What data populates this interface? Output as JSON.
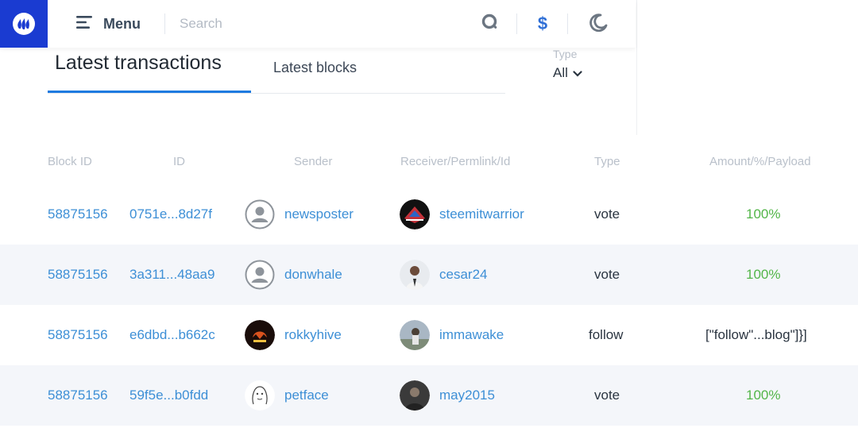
{
  "header": {
    "menu_label": "Menu",
    "search_placeholder": "Search",
    "currency_symbol": "$",
    "brand_color": "#1a3bd1",
    "icons": [
      "steem-logo-icon",
      "menu-icon",
      "search-icon",
      "dollar-icon",
      "moon-icon"
    ]
  },
  "tabs": [
    {
      "label": "Latest transactions",
      "active": true
    },
    {
      "label": "Latest blocks",
      "active": false
    }
  ],
  "filter": {
    "label": "Type",
    "value": "All"
  },
  "table": {
    "columns": [
      "Block ID",
      "ID",
      "Sender",
      "Receiver/Permlink/Id",
      "Type",
      "Amount/%/Payload"
    ],
    "rows": [
      {
        "block_id": "58875156",
        "id": "0751e...8d27f",
        "sender": "newsposter",
        "receiver": "steemitwarrior",
        "type": "vote",
        "amount": "100%"
      },
      {
        "block_id": "58875156",
        "id": "3a311...48aa9",
        "sender": "donwhale",
        "receiver": "cesar24",
        "type": "vote",
        "amount": "100%"
      },
      {
        "block_id": "58875156",
        "id": "e6dbd...b662c",
        "sender": "rokkyhive",
        "receiver": "immawake",
        "type": "follow",
        "amount": "[\"follow\"...blog\"]}]"
      },
      {
        "block_id": "58875156",
        "id": "59f5e...b0fdd",
        "sender": "petface",
        "receiver": "may2015",
        "type": "vote",
        "amount": "100%"
      }
    ]
  },
  "colors": {
    "link": "#3d8fd6",
    "percent": "#52b548",
    "tab_underline": "#1e7be0"
  }
}
